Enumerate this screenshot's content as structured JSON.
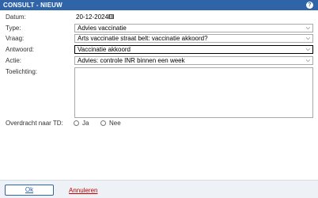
{
  "window": {
    "title": "CONSULT - NIEUW",
    "help": "?"
  },
  "form": {
    "datum_label": "Datum:",
    "datum_value": "20-12-2024",
    "type_label": "Type:",
    "type_value": "Advies vaccinatie",
    "vraag_label": "Vraag:",
    "vraag_value": "Arts vaccinatie straat belt: vaccinatie akkoord?",
    "antwoord_label": "Antwoord:",
    "antwoord_value": "Vaccinatie akkoord",
    "actie_label": "Actie:",
    "actie_value": "Advies: controle INR binnen een week",
    "toelichting_label": "Toelichting:",
    "overdracht_label": "Overdracht naar TD:",
    "option_ja": "Ja",
    "option_nee": "Nee"
  },
  "footer": {
    "ok_label": "Ok",
    "cancel_label": "Annuleren"
  },
  "icons": {
    "calendar": "calendar-icon",
    "chevron": "chevron-down-icon",
    "help": "help-icon"
  },
  "colors": {
    "titlebar": "#2f64a8",
    "cancel": "#c00000"
  }
}
